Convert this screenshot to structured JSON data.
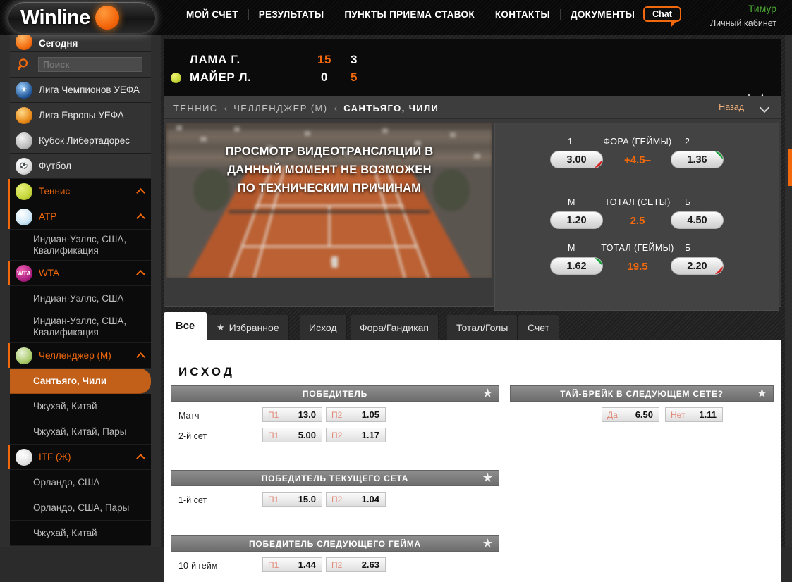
{
  "header": {
    "logo_text": "Winline",
    "nav": [
      {
        "label": "МОЙ СЧЕТ"
      },
      {
        "label": "РЕЗУЛЬТАТЫ"
      },
      {
        "label": "ПУНКТЫ ПРИЕМА СТАВОК"
      },
      {
        "label": "КОНТАКТЫ"
      },
      {
        "label": "ДОКУМЕНТЫ"
      }
    ],
    "chat_label": "Chat",
    "user_name": "Тимур",
    "account_link": "Личный кабинет",
    "accent_color": "#f2680c",
    "user_color": "#4aa832"
  },
  "sidebar": {
    "search_placeholder": "Поиск",
    "search_value": "",
    "items": [
      {
        "label": "Сегодня",
        "icon": "clock-icon",
        "type": "today"
      },
      {
        "label": "Лига Чемпионов УЕФА",
        "icon": "ucl-icon",
        "type": "sport"
      },
      {
        "label": "Лига Европы УЕФА",
        "icon": "uel-icon",
        "type": "sport"
      },
      {
        "label": "Кубок Либертадорес",
        "icon": "libertadores-icon",
        "type": "sport"
      },
      {
        "label": "Футбол",
        "icon": "soccer-ball-icon",
        "type": "sport"
      },
      {
        "label": "Теннис",
        "icon": "tennis-ball-icon",
        "type": "group"
      },
      {
        "label": "ATP",
        "icon": "atp-icon",
        "type": "group"
      },
      {
        "label": "Индиан-Уэллс, США, Квалификация",
        "icon": "",
        "type": "leaf"
      },
      {
        "label": "WTA",
        "icon": "wta-icon",
        "type": "group"
      },
      {
        "label": "Индиан-Уэллс, США",
        "icon": "",
        "type": "leaf"
      },
      {
        "label": "Индиан-Уэллс, США, Квалификация",
        "icon": "",
        "type": "leaf"
      },
      {
        "label": "Челленджер (М)",
        "icon": "challenger-icon",
        "type": "group"
      },
      {
        "label": "Сантьяго, Чили",
        "icon": "",
        "type": "selected"
      },
      {
        "label": "Чжухай, Китай",
        "icon": "",
        "type": "leaf"
      },
      {
        "label": "Чжухай, Китай, Пары",
        "icon": "",
        "type": "leaf"
      },
      {
        "label": "ITF (Ж)",
        "icon": "itf-icon",
        "type": "group"
      },
      {
        "label": "Орландо, США",
        "icon": "",
        "type": "leaf"
      },
      {
        "label": "Орландо, США, Пары",
        "icon": "",
        "type": "leaf"
      },
      {
        "label": "Чжухай, Китай",
        "icon": "",
        "type": "leaf"
      }
    ]
  },
  "scoreboard": {
    "player1": {
      "name": "ЛАМА Г.",
      "points": "15",
      "games": "3"
    },
    "player2": {
      "name": "МАЙЕР Л.",
      "points": "0",
      "games": "5"
    },
    "serving": "player2"
  },
  "breadcrumb": {
    "items": [
      "ТЕННИС",
      "ЧЕЛЛЕНДЖЕР (М)",
      "САНТЬЯГО, ЧИЛИ"
    ],
    "separator": "‹",
    "back_label": "Назад"
  },
  "video": {
    "message_line1": "ПРОСМОТР ВИДЕОТРАНСЛЯЦИИ В",
    "message_line2": "ДАННЫЙ МОМЕНТ НЕ ВОЗМОЖЕН",
    "message_line3": "ПО ТЕХНИЧЕСКИМ ПРИЧИНАМ"
  },
  "quick_odds": [
    {
      "title": "ФОРА (ГЕЙМЫ)",
      "col1": "1",
      "col2": "2",
      "mid": "+4.5–",
      "odd1": "3.00",
      "odd2": "1.36",
      "trend1": "down",
      "trend2": "up"
    },
    {
      "title": "ТОТАЛ (СЕТЫ)",
      "col1": "М",
      "col2": "Б",
      "mid": "2.5",
      "odd1": "1.20",
      "odd2": "4.50",
      "trend1": "none",
      "trend2": "none"
    },
    {
      "title": "ТОТАЛ (ГЕЙМЫ)",
      "col1": "М",
      "col2": "Б",
      "mid": "19.5",
      "odd1": "1.62",
      "odd2": "2.20",
      "trend1": "up",
      "trend2": "down"
    }
  ],
  "tabs": [
    {
      "label": "Все",
      "active": true,
      "star": false
    },
    {
      "label": "Избранное",
      "active": false,
      "star": true
    },
    {
      "label": "Исход",
      "active": false,
      "star": false
    },
    {
      "label": "Фора/Гандикап",
      "active": false,
      "star": false
    },
    {
      "label": "Тотал/Голы",
      "active": false,
      "star": false
    },
    {
      "label": "Счет",
      "active": false,
      "star": false
    }
  ],
  "market_section": {
    "title": "ИСХОД",
    "cards_left": [
      {
        "title": "ПОБЕДИТЕЛЬ",
        "rows": [
          {
            "label": "Матч",
            "o1_label": "П1",
            "o1_value": "13.0",
            "o2_label": "П2",
            "o2_value": "1.05"
          },
          {
            "label": "2-й сет",
            "o1_label": "П1",
            "o1_value": "5.00",
            "o2_label": "П2",
            "o2_value": "1.17"
          }
        ]
      },
      {
        "title": "ПОБЕДИТЕЛЬ ТЕКУЩЕГО СЕТА",
        "rows": [
          {
            "label": "1-й сет",
            "o1_label": "П1",
            "o1_value": "15.0",
            "o2_label": "П2",
            "o2_value": "1.04"
          }
        ]
      },
      {
        "title": "ПОБЕДИТЕЛЬ СЛЕДУЮЩЕГО ГЕЙМА",
        "rows": [
          {
            "label": "10-й гейм",
            "o1_label": "П1",
            "o1_value": "1.44",
            "o2_label": "П2",
            "o2_value": "2.63"
          }
        ]
      }
    ],
    "cards_right": [
      {
        "title": "ТАЙ-БРЕЙК В СЛЕДУЮЩЕМ СЕТЕ?",
        "rows": [
          {
            "label": "",
            "o1_label": "Да",
            "o1_value": "6.50",
            "o2_label": "Нет",
            "o2_value": "1.11"
          }
        ]
      }
    ]
  }
}
